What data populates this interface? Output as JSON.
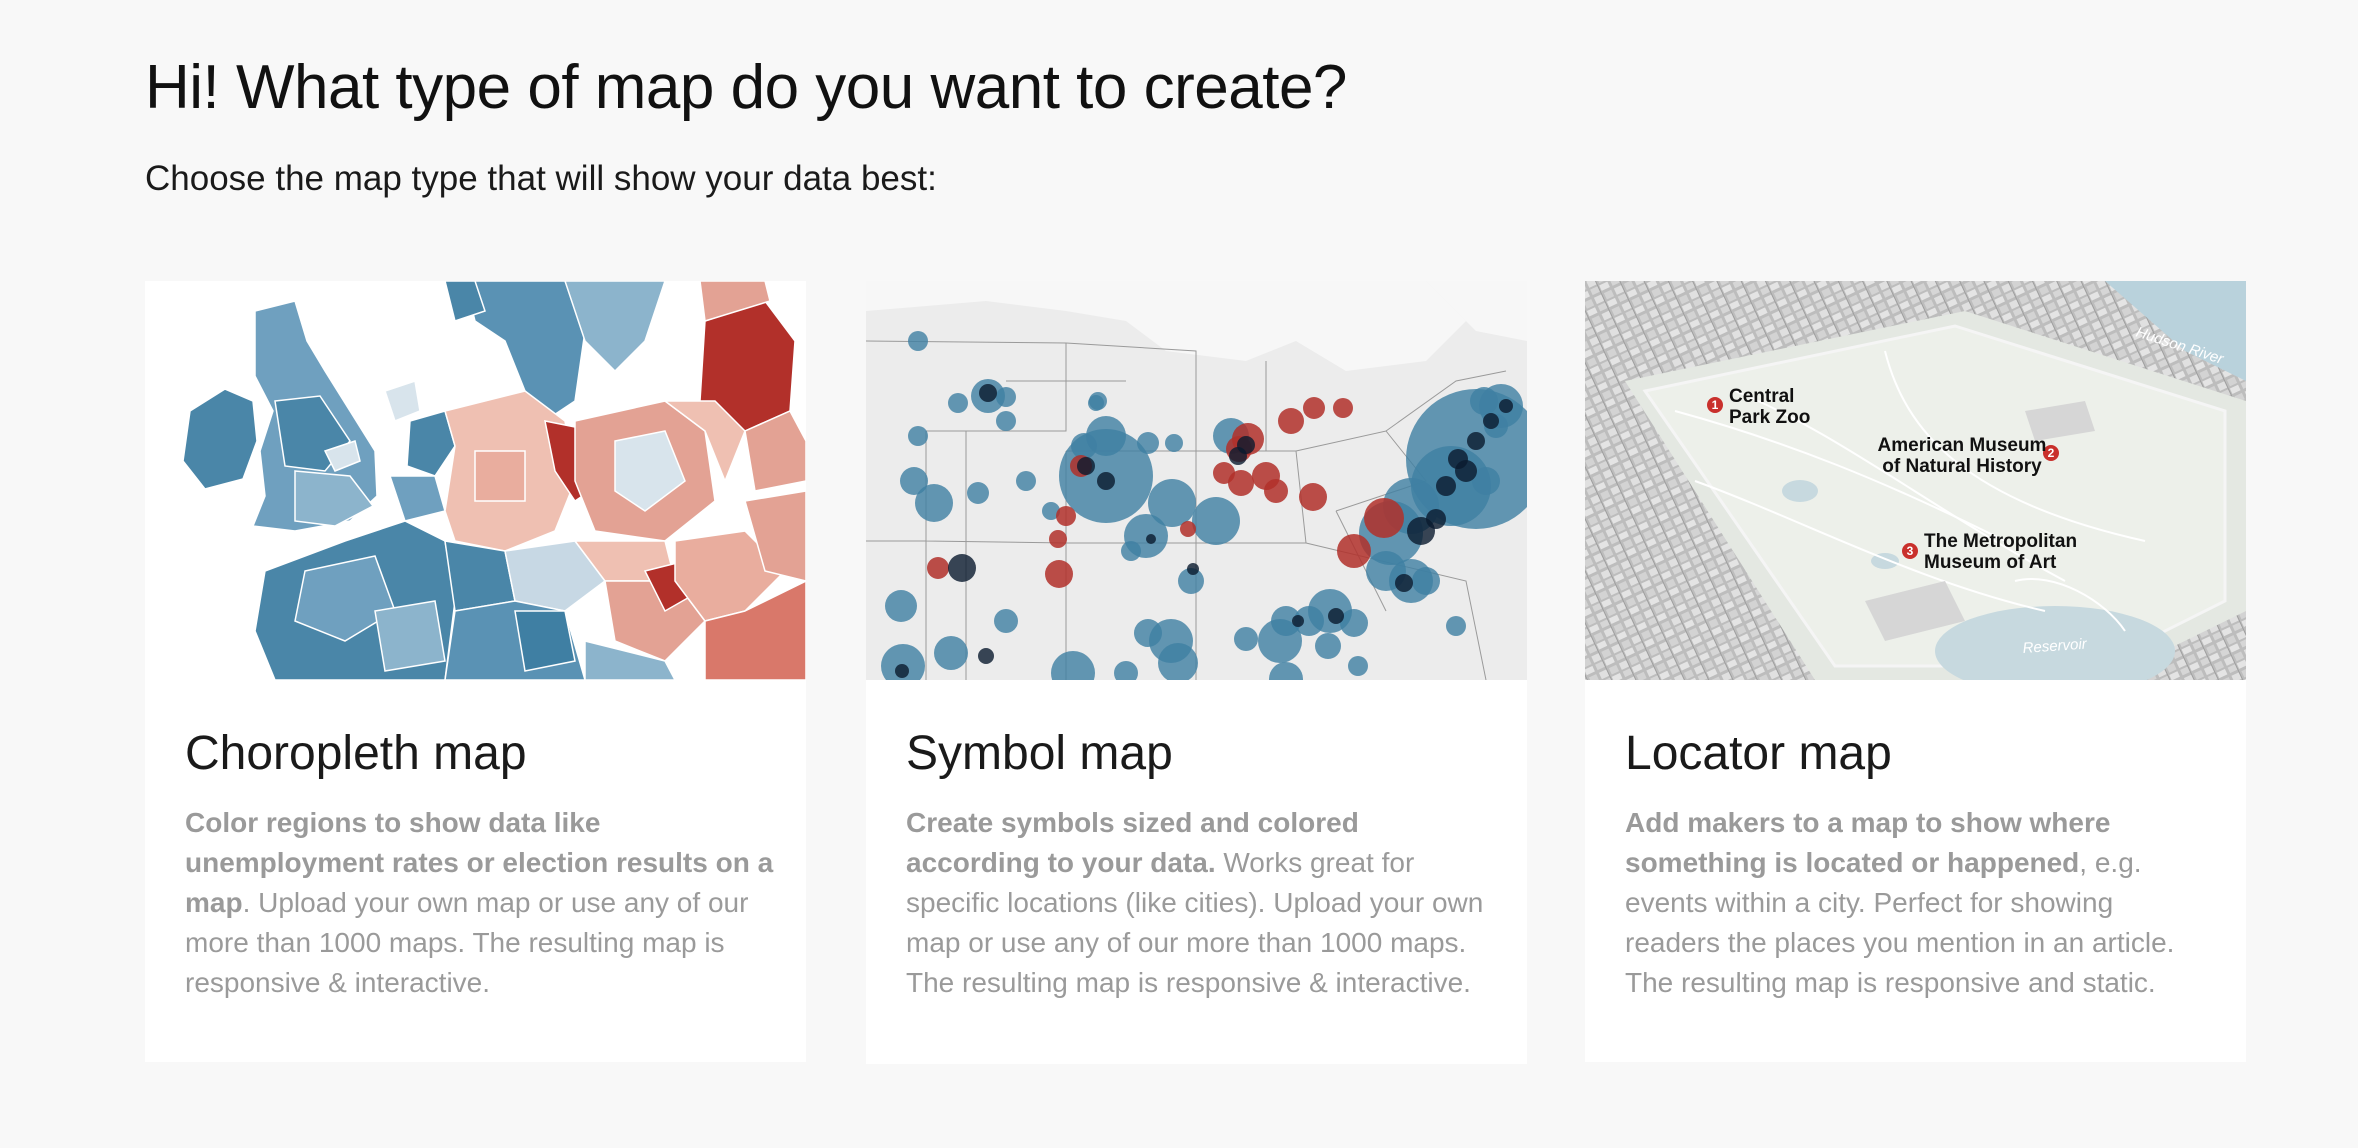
{
  "header": {
    "title": "Hi! What type of map do you want to create?",
    "subtitle": "Choose the map type that will show your data best:"
  },
  "cards": [
    {
      "title": "Choropleth map",
      "desc_bold": "Color regions to show data like unemployment rates or election results on a map",
      "desc_rest": ". Upload your own map or use any of our more than 1000 maps. The resulting map is responsive & interactive.",
      "thumbnail_icon": "choropleth-europe-map"
    },
    {
      "title": "Symbol map",
      "desc_bold": "Create symbols sized and colored according to your data.",
      "desc_rest": " Works great for specific locations (like cities). Upload your own map or use any of our more than 1000 maps. The resulting map is responsive & interactive.",
      "thumbnail_icon": "symbol-us-map"
    },
    {
      "title": "Locator map",
      "desc_bold": "Add makers to a map to show where something is located or happened",
      "desc_rest": ", e.g. events within a city. Perfect for showing readers the places you mention in an article. The resulting map is responsive and static.",
      "thumbnail_icon": "locator-city-map",
      "markers": [
        {
          "num": "1",
          "line1": "Central",
          "line2": "Park Zoo"
        },
        {
          "num": "2",
          "line1": "American Museum",
          "line2": "of Natural History"
        },
        {
          "num": "3",
          "line1": "The Metropolitan",
          "line2": "Museum of Art"
        }
      ],
      "water_labels": [
        "Hudson River",
        "Reservoir"
      ]
    }
  ],
  "colors": {
    "blue": "#3f7fa3",
    "red": "#b2302a",
    "marker_red": "#c9302c",
    "text_gray": "#9a9a9a",
    "background": "#f8f8f8"
  }
}
